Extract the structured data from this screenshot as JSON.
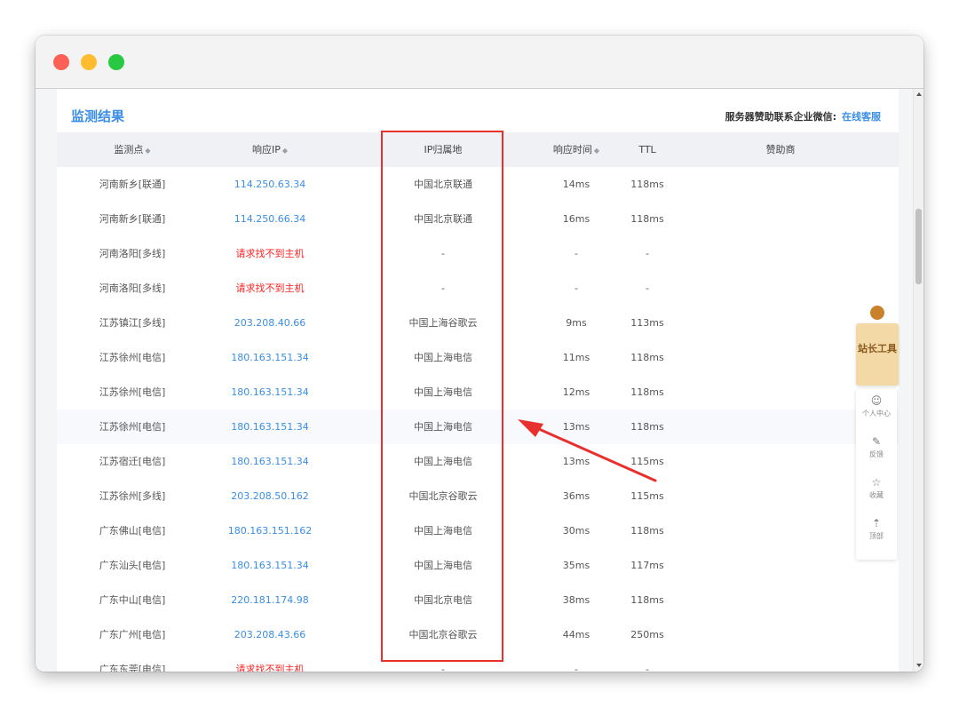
{
  "panel": {
    "title": "监测结果",
    "sponsor_text": "服务器赞助联系企业微信:",
    "sponsor_link": "在线客服"
  },
  "table": {
    "headers": [
      {
        "label": "监测点",
        "sortable": true
      },
      {
        "label": "响应IP",
        "sortable": true
      },
      {
        "label": "IP归属地",
        "sortable": false
      },
      {
        "label": "响应时间",
        "sortable": true
      },
      {
        "label": "TTL",
        "sortable": false
      },
      {
        "label": "赞助商",
        "sortable": false
      }
    ],
    "sort_icon": "◆",
    "rows": [
      {
        "node": "河南新乡[联通]",
        "ip": "114.250.63.34",
        "error": false,
        "location": "中国北京联通",
        "time": "14ms",
        "ttl": "118ms"
      },
      {
        "node": "河南新乡[联通]",
        "ip": "114.250.66.34",
        "error": false,
        "location": "中国北京联通",
        "time": "16ms",
        "ttl": "118ms"
      },
      {
        "node": "河南洛阳[多线]",
        "ip": "请求找不到主机",
        "error": true,
        "location": "-",
        "time": "-",
        "ttl": "-"
      },
      {
        "node": "河南洛阳[多线]",
        "ip": "请求找不到主机",
        "error": true,
        "location": "-",
        "time": "-",
        "ttl": "-"
      },
      {
        "node": "江苏镇江[多线]",
        "ip": "203.208.40.66",
        "error": false,
        "location": "中国上海谷歌云",
        "time": "9ms",
        "ttl": "113ms"
      },
      {
        "node": "江苏徐州[电信]",
        "ip": "180.163.151.34",
        "error": false,
        "location": "中国上海电信",
        "time": "11ms",
        "ttl": "118ms"
      },
      {
        "node": "江苏徐州[电信]",
        "ip": "180.163.151.34",
        "error": false,
        "location": "中国上海电信",
        "time": "12ms",
        "ttl": "118ms"
      },
      {
        "node": "江苏徐州[电信]",
        "ip": "180.163.151.34",
        "error": false,
        "location": "中国上海电信",
        "time": "13ms",
        "ttl": "118ms"
      },
      {
        "node": "江苏宿迁[电信]",
        "ip": "180.163.151.34",
        "error": false,
        "location": "中国上海电信",
        "time": "13ms",
        "ttl": "115ms"
      },
      {
        "node": "江苏徐州[多线]",
        "ip": "203.208.50.162",
        "error": false,
        "location": "中国北京谷歌云",
        "time": "36ms",
        "ttl": "115ms"
      },
      {
        "node": "广东佛山[电信]",
        "ip": "180.163.151.162",
        "error": false,
        "location": "中国上海电信",
        "time": "30ms",
        "ttl": "118ms"
      },
      {
        "node": "广东汕头[电信]",
        "ip": "180.163.151.34",
        "error": false,
        "location": "中国上海电信",
        "time": "35ms",
        "ttl": "117ms"
      },
      {
        "node": "广东中山[电信]",
        "ip": "220.181.174.98",
        "error": false,
        "location": "中国北京电信",
        "time": "38ms",
        "ttl": "118ms"
      },
      {
        "node": "广东广州[电信]",
        "ip": "203.208.43.66",
        "error": false,
        "location": "中国北京谷歌云",
        "time": "44ms",
        "ttl": "250ms"
      },
      {
        "node": "广东东莞[电信]",
        "ip": "请求找不到主机",
        "error": true,
        "location": "-",
        "time": "-",
        "ttl": "-"
      }
    ]
  },
  "side_widget": {
    "main_label": "站长工具",
    "items": [
      {
        "icon": "user-icon",
        "label": "个人中心"
      },
      {
        "icon": "feedback-icon",
        "label": "反馈"
      },
      {
        "icon": "favorite-icon",
        "label": "收藏"
      },
      {
        "icon": "top-icon",
        "label": "顶部"
      }
    ]
  },
  "colors": {
    "accent": "#3a8ee6",
    "error": "#ff2222",
    "highlight": "#e8312f"
  }
}
